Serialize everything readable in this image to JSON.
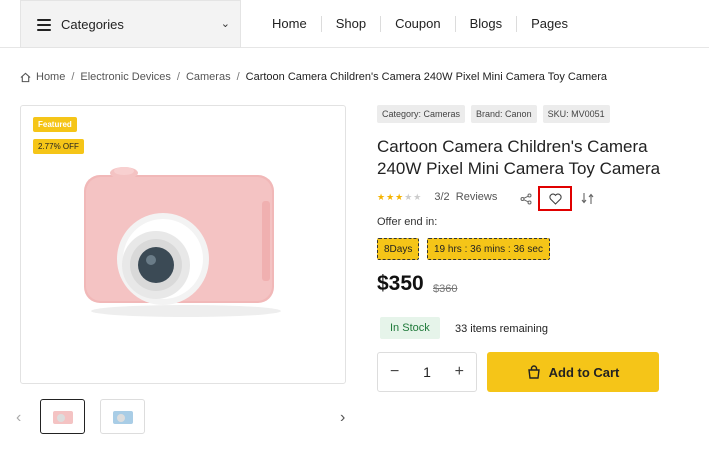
{
  "header": {
    "categories_label": "Categories",
    "nav": [
      "Home",
      "Shop",
      "Coupon",
      "Blogs",
      "Pages"
    ]
  },
  "breadcrumb": {
    "items": [
      "Home",
      "Electronic Devices",
      "Cameras"
    ],
    "current": "Cartoon Camera Children's Camera 240W Pixel Mini Camera Toy Camera"
  },
  "gallery": {
    "badge_featured": "Featured",
    "badge_discount": "2.77% OFF"
  },
  "product": {
    "tags": [
      "Category: Cameras",
      "Brand: Canon",
      "SKU: MV0051"
    ],
    "title": "Cartoon Camera Children's Camera 240W Pixel Mini Camera Toy Camera",
    "rating_text": "3/2",
    "reviews_label": "Reviews",
    "rating_stars": 3,
    "offer_label": "Offer end in:",
    "countdown_days": "8Days",
    "countdown_time": "19 hrs : 36 mins : 36 sec",
    "price": "$350",
    "old_price": "$360",
    "stock_status": "In Stock",
    "remaining": "33 items remaining",
    "quantity": "1",
    "add_to_cart": "Add to Cart"
  },
  "colors": {
    "accent": "#f5c518",
    "highlight_border": "#e00000",
    "stock_green": "#1f7a3a"
  }
}
